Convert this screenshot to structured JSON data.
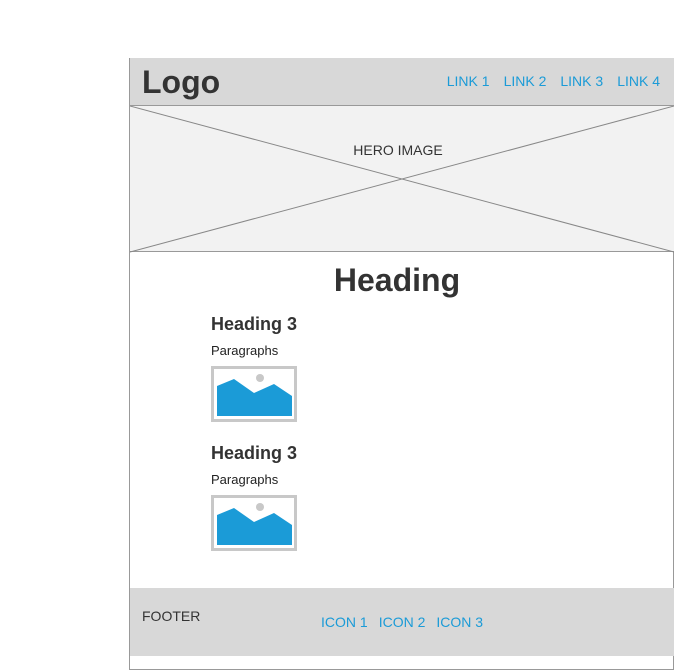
{
  "header": {
    "logo": "Logo",
    "links": [
      "LINK 1",
      "LINK 2",
      "LINK 3",
      "LINK 4"
    ]
  },
  "hero": {
    "label": "HERO IMAGE"
  },
  "main": {
    "heading": "Heading",
    "sections": [
      {
        "heading": "Heading 3",
        "paragraph": "Paragraphs",
        "image_icon": "image-placeholder-icon"
      },
      {
        "heading": "Heading 3",
        "paragraph": "Paragraphs",
        "image_icon": "image-placeholder-icon"
      }
    ]
  },
  "footer": {
    "label": "FOOTER",
    "icons": [
      "ICON 1",
      "ICON 2",
      "ICON 3"
    ]
  },
  "colors": {
    "accent": "#1b9bd7",
    "bar_background": "#d8d8d8",
    "hero_background": "#f2f2f2"
  }
}
